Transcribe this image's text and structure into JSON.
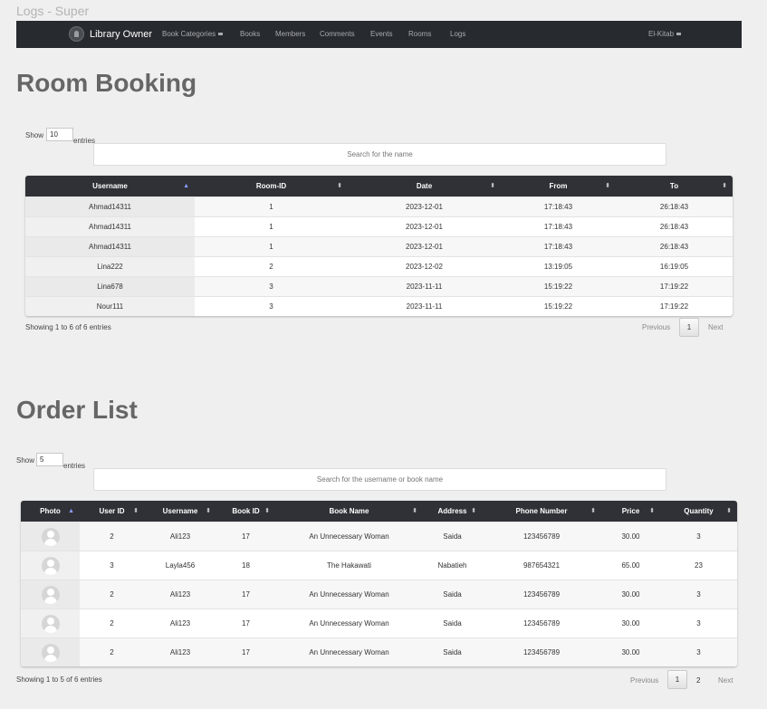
{
  "page": {
    "tab_title": "Logs - Super"
  },
  "navbar": {
    "brand": "Library Owner",
    "links": [
      "Book Categories",
      "Books",
      "Members",
      "Comments",
      "Events",
      "Rooms",
      "Logs"
    ],
    "user": "El-Kitab"
  },
  "rooms": {
    "title": "Room Booking",
    "show_label": "Show",
    "show_value": "10",
    "entries_label": "entries",
    "search_placeholder": "Search for the name",
    "columns": [
      "Username",
      "Room-ID",
      "Date",
      "From",
      "To"
    ],
    "sorted_column": "Username",
    "rows": [
      [
        "Ahmad14311",
        "1",
        "2023-12-01",
        "17:18:43",
        "26:18:43"
      ],
      [
        "Ahmad14311",
        "1",
        "2023-12-01",
        "17:18:43",
        "26:18:43"
      ],
      [
        "Ahmad14311",
        "1",
        "2023-12-01",
        "17:18:43",
        "26:18:43"
      ],
      [
        "Lina222",
        "2",
        "2023-12-02",
        "13:19:05",
        "16:19:05"
      ],
      [
        "Lina678",
        "3",
        "2023-11-11",
        "15:19:22",
        "17:19:22"
      ],
      [
        "Nour111",
        "3",
        "2023-11-11",
        "15:19:22",
        "17:19:22"
      ]
    ],
    "info": "Showing 1 to 6 of 6 entries",
    "pagination": {
      "previous": "Previous",
      "pages": [
        "1"
      ],
      "current": "1",
      "next": "Next"
    }
  },
  "orders": {
    "title": "Order List",
    "show_label": "Show",
    "show_value": "5",
    "entries_label": "entries",
    "search_placeholder": "Search for the username or book name",
    "columns": [
      "Photo",
      "User ID",
      "Username",
      "Book ID",
      "Book Name",
      "Address",
      "Phone Number",
      "Price",
      "Quantity"
    ],
    "sorted_column": "Photo",
    "rows": [
      [
        "avatar-icon",
        "2",
        "Ali123",
        "17",
        "An Unnecessary Woman",
        "Saida",
        "123456789",
        "30.00",
        "3"
      ],
      [
        "avatar-icon",
        "3",
        "Layla456",
        "18",
        "The Hakawati",
        "Nabatieh",
        "987654321",
        "65.00",
        "23"
      ],
      [
        "avatar-icon",
        "2",
        "Ali123",
        "17",
        "An Unnecessary Woman",
        "Saida",
        "123456789",
        "30.00",
        "3"
      ],
      [
        "avatar-icon",
        "2",
        "Ali123",
        "17",
        "An Unnecessary Woman",
        "Saida",
        "123456789",
        "30.00",
        "3"
      ],
      [
        "avatar-icon",
        "2",
        "Ali123",
        "17",
        "An Unnecessary Woman",
        "Saida",
        "123456789",
        "30.00",
        "3"
      ]
    ],
    "info": "Showing 1 to 5 of 6 entries",
    "pagination": {
      "previous": "Previous",
      "pages": [
        "1",
        "2"
      ],
      "current": "1",
      "next": "Next"
    }
  }
}
